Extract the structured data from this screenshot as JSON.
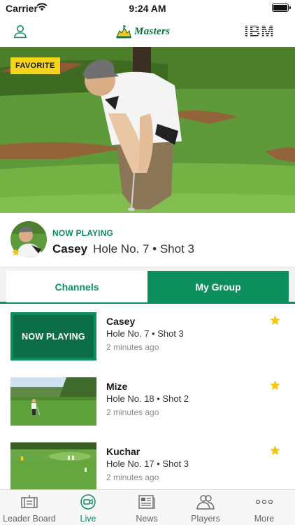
{
  "status_bar": {
    "carrier": "Carrier",
    "time": "9:24 AM",
    "icons": [
      "wifi-icon",
      "battery-icon"
    ]
  },
  "header": {
    "brand": "Masters",
    "sponsor": "IBM",
    "icons": [
      "profile-icon",
      "masters-logo",
      "ibm-logo"
    ]
  },
  "video": {
    "badge": "FAVORITE"
  },
  "now_playing": {
    "kicker": "NOW PLAYING",
    "player": "Casey",
    "hole": "Hole No. 7 • Shot 3"
  },
  "tabs": {
    "channels": "Channels",
    "my_group": "My Group",
    "active": "My Group"
  },
  "feed": [
    {
      "name": "Casey",
      "hole": "Hole No. 7 • Shot 3",
      "time": "2 minutes ago",
      "thumb_label": "NOW PLAYING",
      "favorite": true
    },
    {
      "name": "Mize",
      "hole": "Hole No. 18 • Shot 2",
      "time": "2 minutes ago",
      "favorite": true
    },
    {
      "name": "Kuchar",
      "hole": "Hole No. 17 • Shot 3",
      "time": "2 minutes ago",
      "favorite": true
    }
  ],
  "bottom_tabs": [
    {
      "label": "Leader Board",
      "icon": "leaderboard-icon"
    },
    {
      "label": "Live",
      "icon": "live-video-icon",
      "active": true
    },
    {
      "label": "News",
      "icon": "news-icon"
    },
    {
      "label": "Players",
      "icon": "players-icon"
    },
    {
      "label": "More",
      "icon": "more-icon"
    }
  ],
  "colors": {
    "accent": "#0c8f5d",
    "accent_dark": "#0b6e49",
    "favorite": "#f5d41c",
    "brand_green": "#0b6b3a"
  }
}
